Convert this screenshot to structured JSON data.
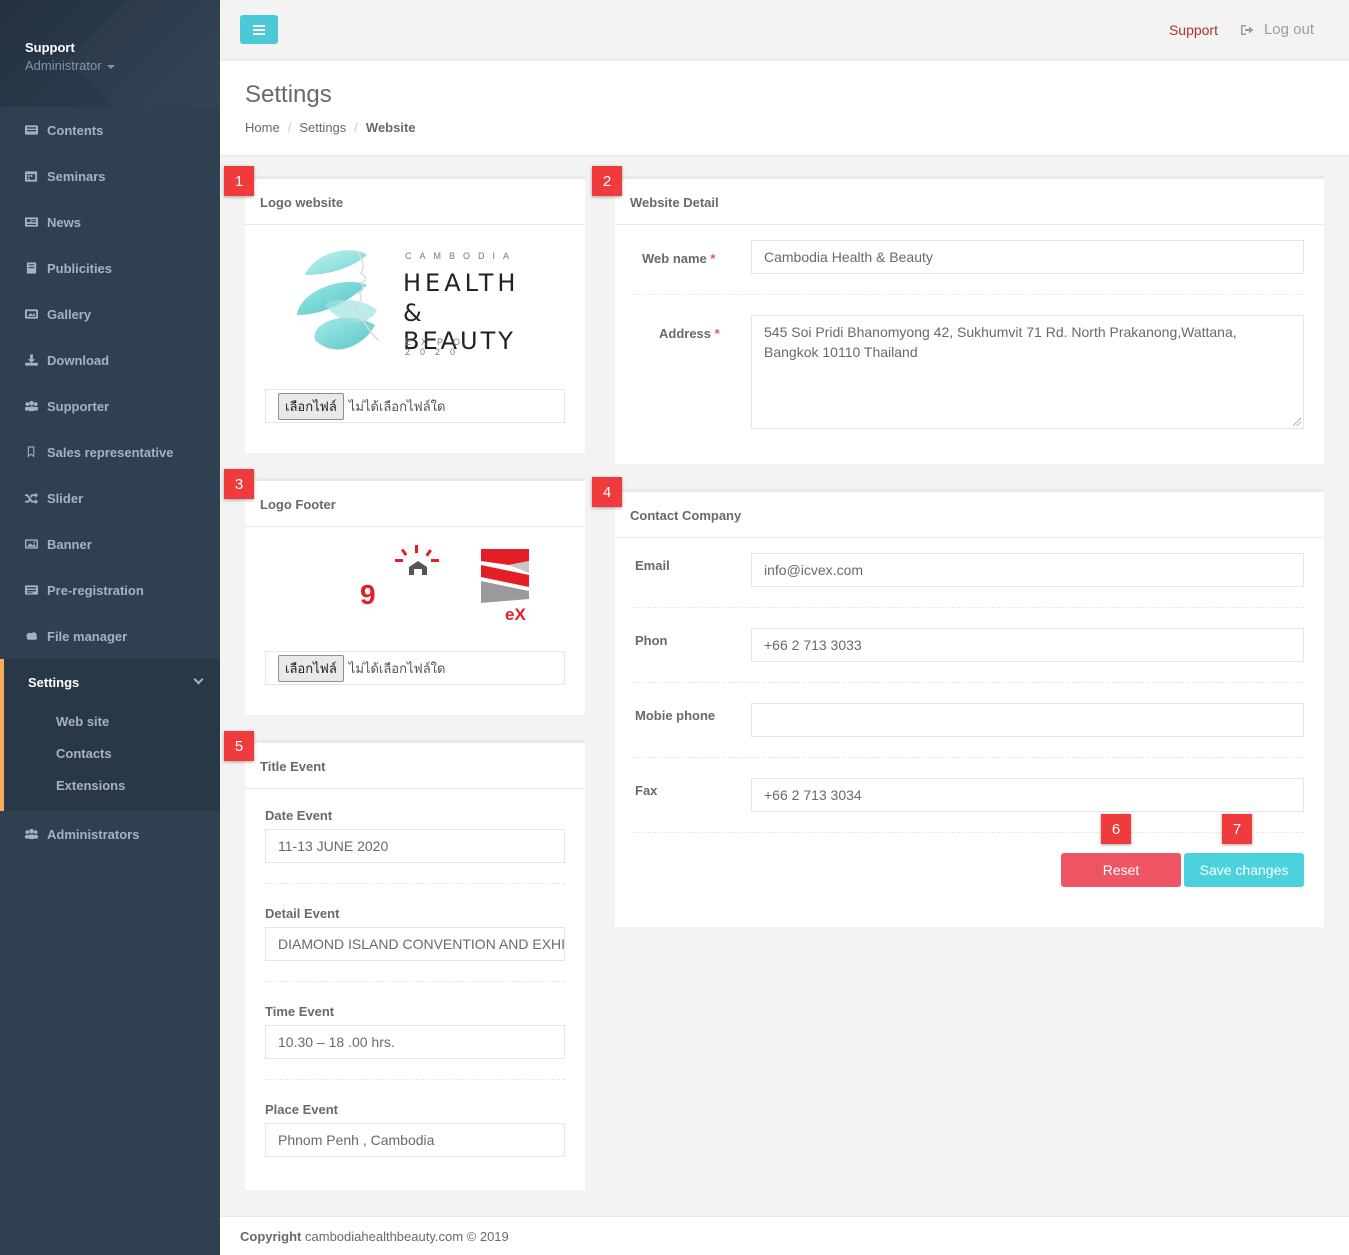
{
  "profile": {
    "name": "Support",
    "role": "Administrator"
  },
  "sidebar": {
    "items": [
      {
        "label": "Contents",
        "icon": "contents-icon"
      },
      {
        "label": "Seminars",
        "icon": "calendar-icon"
      },
      {
        "label": "News",
        "icon": "newspaper-icon"
      },
      {
        "label": "Publicities",
        "icon": "book-icon"
      },
      {
        "label": "Gallery",
        "icon": "picture-icon"
      },
      {
        "label": "Download",
        "icon": "download-icon"
      },
      {
        "label": "Supporter",
        "icon": "users-icon"
      },
      {
        "label": "Sales representative",
        "icon": "bookmark-icon"
      },
      {
        "label": "Slider",
        "icon": "shuffle-icon"
      },
      {
        "label": "Banner",
        "icon": "image-icon"
      },
      {
        "label": "Pre-registration",
        "icon": "list-icon"
      },
      {
        "label": "File manager",
        "icon": "cloud-icon"
      }
    ],
    "active": {
      "label": "Settings",
      "icon": "gears-icon",
      "children": [
        "Web site",
        "Contacts",
        "Extensions"
      ]
    },
    "after": {
      "label": "Administrators",
      "icon": "users-icon"
    }
  },
  "topbar": {
    "support": "Support",
    "logout": "Log out"
  },
  "heading": {
    "title": "Settings",
    "crumbs": [
      "Home",
      "Settings",
      "Website"
    ]
  },
  "badges": [
    "1",
    "2",
    "3",
    "4",
    "5",
    "6",
    "7"
  ],
  "logo_website": {
    "title": "Logo website",
    "logo_small": "CAMBODIA",
    "logo_line1": "HEALTH",
    "logo_line2": "& BEAUTY",
    "logo_tag": "EXPO 2020",
    "file_button": "เลือกไฟล์",
    "file_status": "ไม่ได้เลือกไฟล์ใด"
  },
  "logo_footer": {
    "title": "Logo Footer",
    "mark1": "9",
    "mark2": "eX",
    "file_button": "เลือกไฟล์",
    "file_status": "ไม่ได้เลือกไฟล์ใด"
  },
  "title_event": {
    "title": "Title Event",
    "date_label": "Date Event",
    "date_value": "11-13 JUNE 2020",
    "detail_label": "Detail Event",
    "detail_value": "DIAMOND ISLAND CONVENTION AND EXHIBITION CENTER",
    "time_label": "Time Event",
    "time_value": "10.30 – 18 .00 hrs.",
    "place_label": "Place Event",
    "place_value": "Phnom Penh , Cambodia"
  },
  "website_detail": {
    "title": "Website Detail",
    "webname_label": "Web name",
    "webname_value": "Cambodia Health & Beauty",
    "address_label": "Address",
    "address_value": "545 Soi Pridi Bhanomyong 42, Sukhumvit 71 Rd. North Prakanong,Wattana, Bangkok 10110 Thailand",
    "required_mark": "*"
  },
  "contact_company": {
    "title": "Contact Company",
    "email_label": "Email",
    "email_value": "info@icvex.com",
    "phone_label": "Phon",
    "phone_value": "+66 2 713 3033",
    "mobile_label": "Mobie phone",
    "mobile_value": "",
    "fax_label": "Fax",
    "fax_value": "+66 2 713 3034",
    "reset": "Reset",
    "save": "Save changes"
  },
  "footer": {
    "copyright": "Copyright",
    "text": "cambodiahealthbeauty.com © 2019"
  },
  "colors": {
    "sidebar": "#2f4050",
    "accent": "#4cc9d6",
    "reset": "#ed5565",
    "save": "#4cd2dd",
    "badge": "#ef3b3b",
    "support_link": "#b2322b",
    "active_border": "#f8ac59"
  }
}
